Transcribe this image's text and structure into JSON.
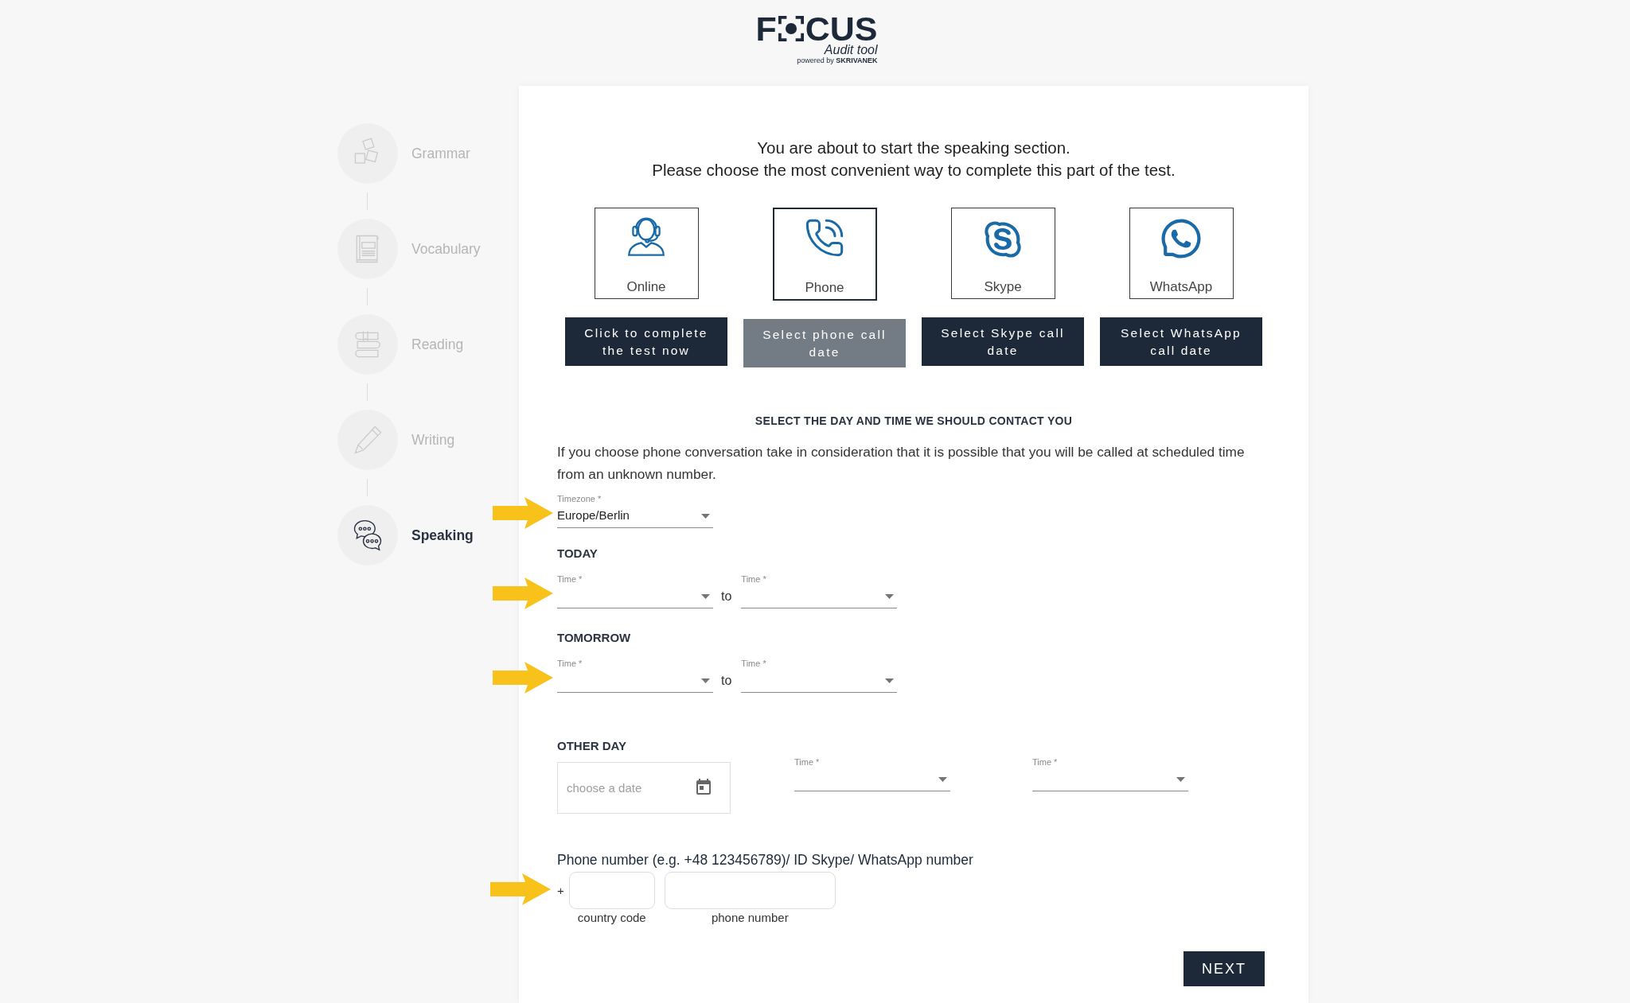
{
  "logo": {
    "left": "F",
    "right": "CUS",
    "subtitle": "Audit tool",
    "credit": "powered by **SKRIVANEK**"
  },
  "sidebar": {
    "items": [
      {
        "label": "Grammar",
        "current": false
      },
      {
        "label": "Vocabulary",
        "current": false
      },
      {
        "label": "Reading",
        "current": false
      },
      {
        "label": "Writing",
        "current": false
      },
      {
        "label": "Speaking",
        "current": true
      }
    ]
  },
  "intro": [
    "You are about to start the speaking section.",
    "Please choose the most convenient way to complete this part of the test."
  ],
  "options": [
    {
      "label": "Online",
      "selected": false,
      "button": "Click to complete the test now"
    },
    {
      "label": "Phone",
      "selected": true,
      "button": "Select phone call date"
    },
    {
      "label": "Skype",
      "selected": false,
      "button": "Select Skype call date"
    },
    {
      "label": "WhatsApp",
      "selected": false,
      "button": "Select WhatsApp call date"
    }
  ],
  "contact": {
    "heading": "SELECT THE DAY AND TIME WE SHOULD CONTACT YOU",
    "note": "If you choose phone conversation take in consideration that it is possible that you will be called at scheduled time from an unknown number.",
    "timezone": {
      "label": "Timezone *",
      "value": "Europe/Berlin",
      "arrow": true
    },
    "days": [
      {
        "title": "TODAY",
        "arrow": true,
        "from": {
          "label": "Time *"
        },
        "separator": "to",
        "until": {
          "label": "Time *"
        }
      },
      {
        "title": "TOMORROW",
        "arrow": true,
        "from": {
          "label": "Time *"
        },
        "separator": "to",
        "until": {
          "label": "Time *"
        }
      }
    ],
    "other_day": {
      "title": "OTHER DAY",
      "date": {
        "placeholder": "choose a date"
      },
      "from": {
        "label": "Time *"
      },
      "until": {
        "label": "Time *"
      }
    },
    "phone": {
      "label": "Phone number (e.g. +48 123456789)/ ID Skype/ WhatsApp number",
      "arrow": true,
      "prefix": "+",
      "country_code": {
        "caption": "country code"
      },
      "number": {
        "caption": "phone number"
      }
    }
  },
  "next_button": "NEXT"
}
